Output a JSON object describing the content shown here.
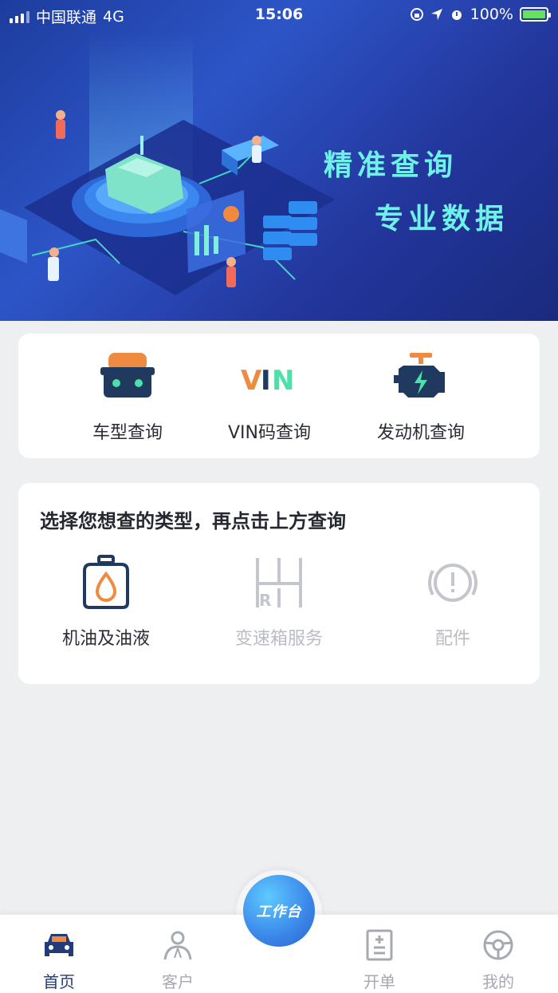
{
  "status_bar": {
    "carrier": "中国联通",
    "network": "4G",
    "time": "15:06",
    "battery": "100%"
  },
  "banner": {
    "line1": "精准查询",
    "line2": "专业数据"
  },
  "query_card": {
    "items": [
      {
        "label": "车型查询",
        "icon": "car-front-icon"
      },
      {
        "label": "VIN码查询",
        "icon": "vin-icon"
      },
      {
        "label": "发动机查询",
        "icon": "engine-icon"
      }
    ]
  },
  "type_card": {
    "title": "选择您想查的类型，再点击上方查询",
    "items": [
      {
        "label": "机油及油液",
        "icon": "oil-can-icon",
        "enabled": true
      },
      {
        "label": "变速箱服务",
        "icon": "gearbox-icon",
        "enabled": false
      },
      {
        "label": "配件",
        "icon": "alert-circle-icon",
        "enabled": false
      }
    ]
  },
  "tabbar": {
    "items": [
      {
        "label": "首页",
        "icon": "car-icon",
        "active": true
      },
      {
        "label": "客户",
        "icon": "user-icon",
        "active": false
      },
      {
        "label": "开单",
        "icon": "document-icon",
        "active": false
      },
      {
        "label": "我的",
        "icon": "steering-wheel-icon",
        "active": false
      }
    ],
    "center_button": "工作台"
  },
  "colors": {
    "accent": "#243b7a",
    "orange": "#f08a40",
    "teal": "#3fd7a0",
    "banner_text": "#6ff0e8",
    "disabled": "#b9bcc2"
  }
}
